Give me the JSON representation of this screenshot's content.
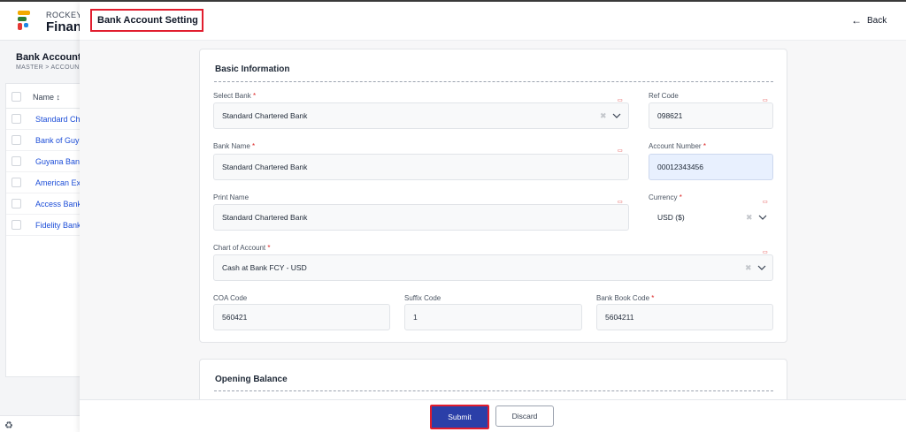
{
  "background": {
    "brand_top": "ROCKEYE",
    "brand_main": "Financ",
    "page_title": "Bank Account",
    "breadcrumb": "MASTER  >  ACCOUN",
    "table_header": "Name  ↕",
    "rows": [
      "Standard Cha",
      "Bank of Guya",
      "Guyana Bank",
      "American Exp",
      "Access Bank",
      "Fidelity Bank"
    ],
    "logo_colors": [
      "#f2a900",
      "#2e7d32",
      "#e53935",
      "#1e88e5"
    ]
  },
  "panel": {
    "title": "Bank Account Setting",
    "back_label": "Back"
  },
  "basic_info": {
    "section_title": "Basic Information",
    "select_bank": {
      "label": "Select Bank",
      "value": "Standard Chartered Bank"
    },
    "ref_code": {
      "label": "Ref Code",
      "value": "098621"
    },
    "bank_name": {
      "label": "Bank Name",
      "value": "Standard Chartered Bank"
    },
    "account_number": {
      "label": "Account Number",
      "value": "00012343456"
    },
    "print_name": {
      "label": "Print Name",
      "value": "Standard Chartered Bank"
    },
    "currency": {
      "label": "Currency",
      "value": "USD ($)"
    },
    "chart_of_account": {
      "label": "Chart of Account",
      "value": "Cash at Bank FCY - USD"
    },
    "coa_code": {
      "label": "COA Code",
      "value": "560421"
    },
    "suffix_code": {
      "label": "Suffix Code",
      "value": "1"
    },
    "bank_book_code": {
      "label": "Bank Book Code",
      "value": "5604211"
    },
    "required_mark": "*",
    "clear_glyph": "✖"
  },
  "opening_balance": {
    "section_title": "Opening Balance"
  },
  "footer": {
    "submit_label": "Submit",
    "discard_label": "Discard"
  },
  "colors": {
    "primary": "#2b3fa8",
    "highlight_border": "#e11d2e",
    "link": "#1d4ed8"
  }
}
